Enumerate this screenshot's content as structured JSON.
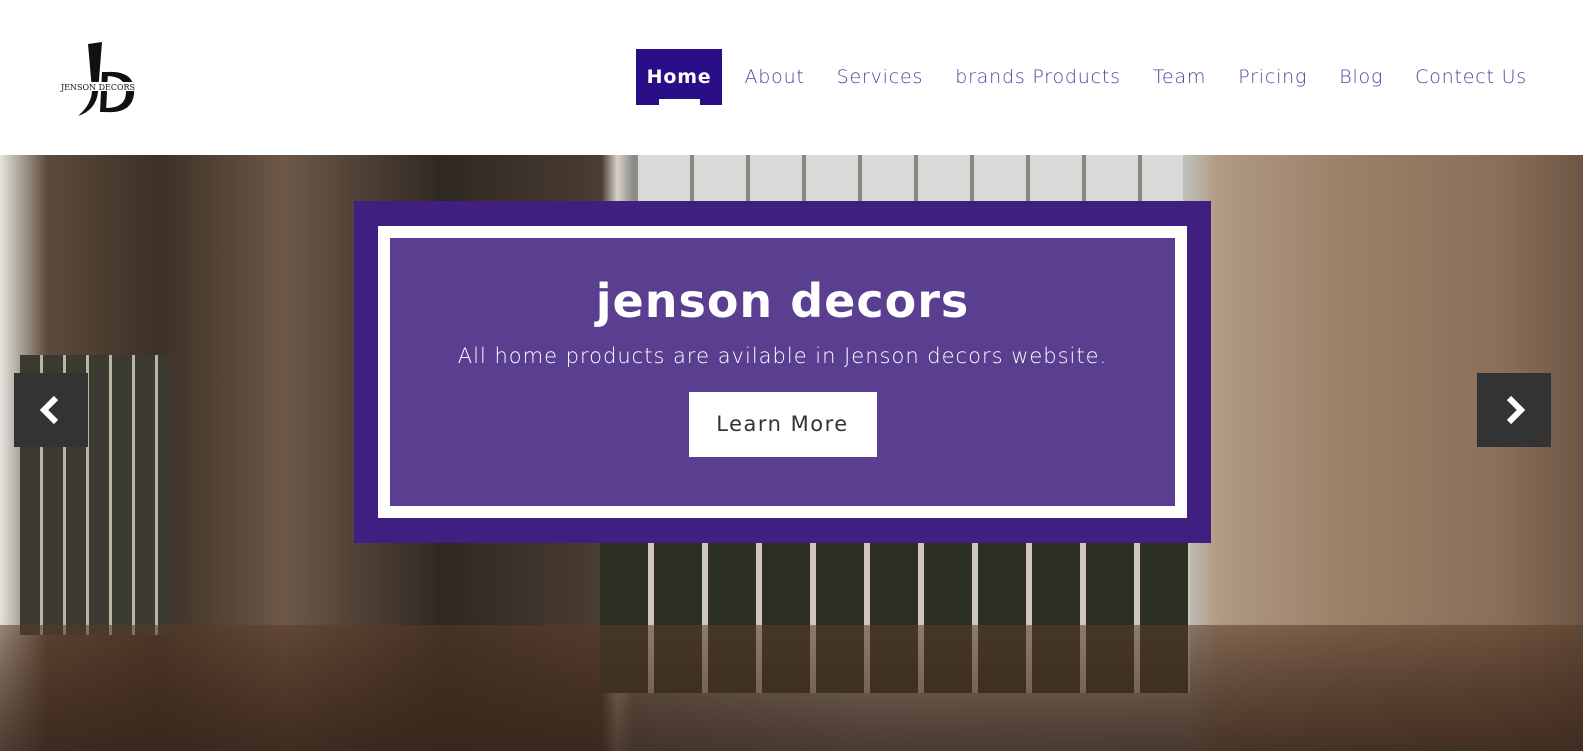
{
  "brand": {
    "logo_text": "JENSON DECORS",
    "logo_monogram": "JD"
  },
  "nav": {
    "items": [
      {
        "label": "Home",
        "active": true
      },
      {
        "label": "About"
      },
      {
        "label": "Services"
      },
      {
        "label": "brands Products"
      },
      {
        "label": "Team"
      },
      {
        "label": "Pricing"
      },
      {
        "label": "Blog"
      },
      {
        "label": "Contect Us"
      }
    ]
  },
  "hero": {
    "title": "jenson decors",
    "subtitle": "All home products are avilable in Jenson decors website.",
    "cta_label": "Learn More",
    "prev_icon": "chevron-left-icon",
    "next_icon": "chevron-right-icon"
  },
  "colors": {
    "accent": "#2a0e87",
    "card_outer": "#3f1f7f",
    "card_inner": "#5a3f91",
    "nav_text": "#5b3a9e"
  }
}
